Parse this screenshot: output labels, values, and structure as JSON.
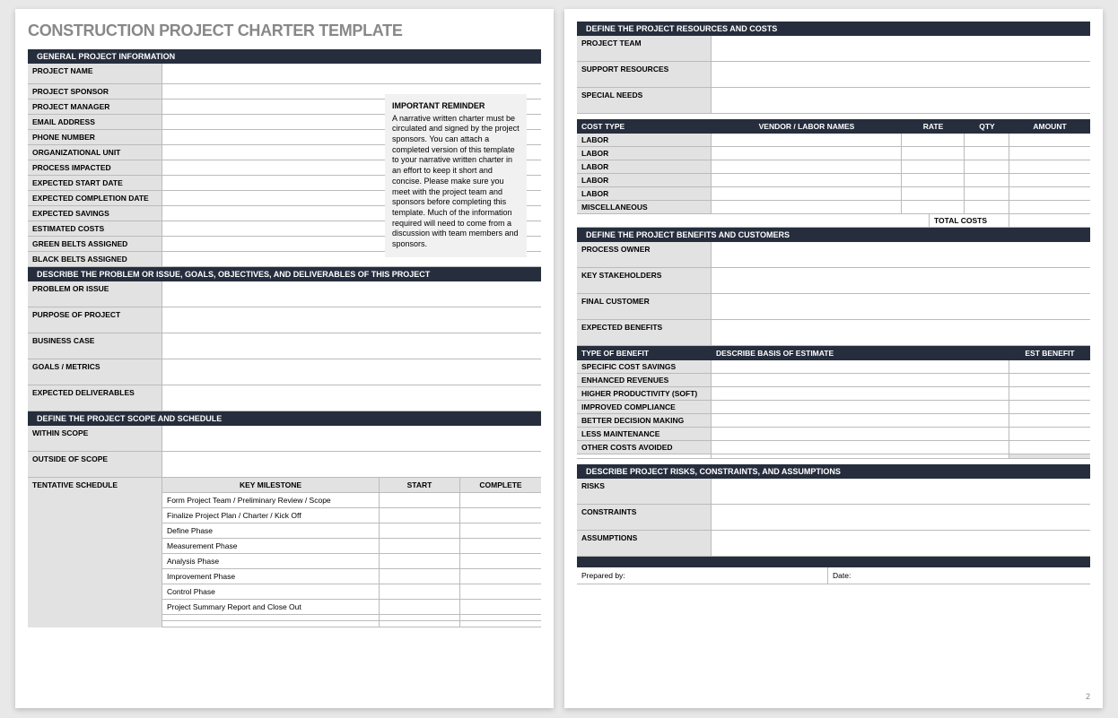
{
  "title": "CONSTRUCTION PROJECT CHARTER TEMPLATE",
  "sections": {
    "general": "GENERAL PROJECT INFORMATION",
    "problem": "DESCRIBE THE PROBLEM OR ISSUE, GOALS, OBJECTIVES, AND DELIVERABLES OF THIS PROJECT",
    "scope": "DEFINE THE PROJECT SCOPE AND SCHEDULE",
    "resources": "DEFINE THE PROJECT RESOURCES AND COSTS",
    "benefits": "DEFINE THE PROJECT BENEFITS AND CUSTOMERS",
    "risks": "DESCRIBE PROJECT RISKS, CONSTRAINTS, AND ASSUMPTIONS"
  },
  "general_fields": [
    "PROJECT NAME",
    "PROJECT SPONSOR",
    "PROJECT MANAGER",
    "EMAIL ADDRESS",
    "PHONE NUMBER",
    "ORGANIZATIONAL UNIT",
    "PROCESS IMPACTED",
    "EXPECTED START DATE",
    "EXPECTED COMPLETION DATE",
    "EXPECTED SAVINGS",
    "ESTIMATED COSTS",
    "GREEN BELTS ASSIGNED",
    "BLACK BELTS ASSIGNED"
  ],
  "reminder": {
    "title": "IMPORTANT REMINDER",
    "text": "A narrative written charter must be circulated and signed by the project sponsors. You can attach a completed version of this template to your narrative written charter in an effort to keep it short and concise. Please make sure you meet with the project team and sponsors before completing this template. Much of the information required will need to come from a discussion with team members and sponsors."
  },
  "problem_fields": [
    "PROBLEM OR ISSUE",
    "PURPOSE OF PROJECT",
    "BUSINESS CASE",
    "GOALS / METRICS",
    "EXPECTED DELIVERABLES"
  ],
  "scope_fields": [
    "WITHIN SCOPE",
    "OUTSIDE OF  SCOPE"
  ],
  "schedule_label": "TENTATIVE SCHEDULE",
  "milestone_headers": [
    "KEY MILESTONE",
    "START",
    "COMPLETE"
  ],
  "milestones": [
    "Form Project Team / Preliminary Review / Scope",
    "Finalize Project Plan / Charter / Kick Off",
    "Define Phase",
    "Measurement Phase",
    "Analysis Phase",
    "Improvement Phase",
    "Control Phase",
    "Project Summary Report and Close Out",
    "",
    ""
  ],
  "resource_fields": [
    "PROJECT TEAM",
    "SUPPORT RESOURCES",
    "SPECIAL NEEDS"
  ],
  "cost_headers": [
    "COST TYPE",
    "VENDOR / LABOR NAMES",
    "RATE",
    "QTY",
    "AMOUNT"
  ],
  "cost_types": [
    "LABOR",
    "LABOR",
    "LABOR",
    "LABOR",
    "LABOR",
    "MISCELLANEOUS"
  ],
  "total_costs_label": "TOTAL COSTS",
  "benefit_fields": [
    "PROCESS OWNER",
    "KEY STAKEHOLDERS",
    "FINAL CUSTOMER",
    "EXPECTED BENEFITS"
  ],
  "benefit_headers": [
    "TYPE OF BENEFIT",
    "DESCRIBE BASIS OF ESTIMATE",
    "EST BENEFIT"
  ],
  "benefit_types": [
    "SPECIFIC COST SAVINGS",
    "ENHANCED REVENUES",
    "HIGHER PRODUCTIVITY (SOFT)",
    "IMPROVED COMPLIANCE",
    "BETTER DECISION MAKING",
    "LESS MAINTENANCE",
    "OTHER COSTS AVOIDED"
  ],
  "risk_fields": [
    "RISKS",
    "CONSTRAINTS",
    "ASSUMPTIONS"
  ],
  "sign": {
    "prepared": "Prepared by:",
    "date": "Date:"
  },
  "pagenum": "2"
}
